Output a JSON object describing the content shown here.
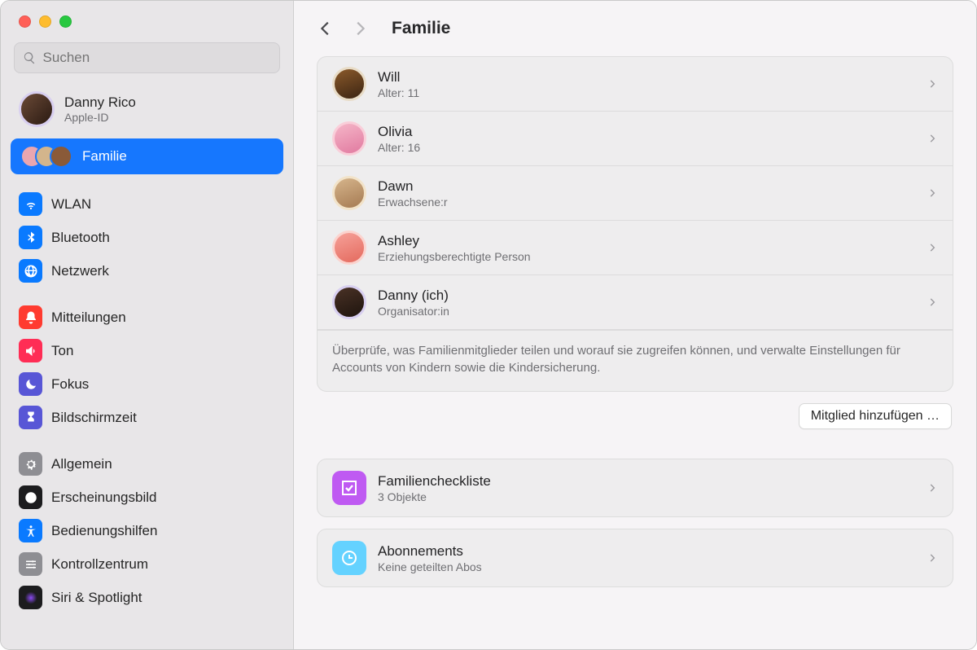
{
  "search": {
    "placeholder": "Suchen"
  },
  "account": {
    "name": "Danny Rico",
    "sub": "Apple-ID"
  },
  "family_pill": {
    "label": "Familie"
  },
  "sidebar": {
    "g1": [
      {
        "label": "WLAN",
        "icon": "wifi",
        "color": "#0a7aff"
      },
      {
        "label": "Bluetooth",
        "icon": "bluetooth",
        "color": "#0a7aff"
      },
      {
        "label": "Netzwerk",
        "icon": "globe",
        "color": "#0a7aff"
      }
    ],
    "g2": [
      {
        "label": "Mitteilungen",
        "icon": "bell",
        "color": "#ff3b30"
      },
      {
        "label": "Ton",
        "icon": "speaker",
        "color": "#ff2d55"
      },
      {
        "label": "Fokus",
        "icon": "moon",
        "color": "#5856d6"
      },
      {
        "label": "Bildschirmzeit",
        "icon": "hourglass",
        "color": "#5856d6"
      }
    ],
    "g3": [
      {
        "label": "Allgemein",
        "icon": "gear",
        "color": "#8e8e93"
      },
      {
        "label": "Erscheinungsbild",
        "icon": "appearance",
        "color": "#1c1c1e"
      },
      {
        "label": "Bedienungshilfen",
        "icon": "accessibility",
        "color": "#0a7aff"
      },
      {
        "label": "Kontrollzentrum",
        "icon": "sliders",
        "color": "#8e8e93"
      },
      {
        "label": "Siri & Spotlight",
        "icon": "siri",
        "color": "#1c1c1e"
      }
    ]
  },
  "page": {
    "title": "Familie"
  },
  "members": [
    {
      "name": "Will",
      "sub": "Alter: 11",
      "avatar": "av-brown"
    },
    {
      "name": "Olivia",
      "sub": "Alter: 16",
      "avatar": "av-pink"
    },
    {
      "name": "Dawn",
      "sub": "Erwachsene:r",
      "avatar": "av-tan"
    },
    {
      "name": "Ashley",
      "sub": "Erziehungsberechtigte Person",
      "avatar": "av-red"
    },
    {
      "name": "Danny (ich)",
      "sub": "Organisator:in",
      "avatar": "av-dark"
    }
  ],
  "members_footer": "Überprüfe, was Familienmitglieder teilen und worauf sie zugreifen können, und verwalte Einstellungen für Accounts von Kindern sowie die Kindersicherung.",
  "add_button": "Mitglied hinzufügen …",
  "settings": {
    "checklist": {
      "title": "Familiencheckliste",
      "sub": "3 Objekte",
      "color": "#bf5af2"
    },
    "subs": {
      "title": "Abonnements",
      "sub": "Keine geteilten Abos",
      "color": "#64d2ff"
    }
  }
}
